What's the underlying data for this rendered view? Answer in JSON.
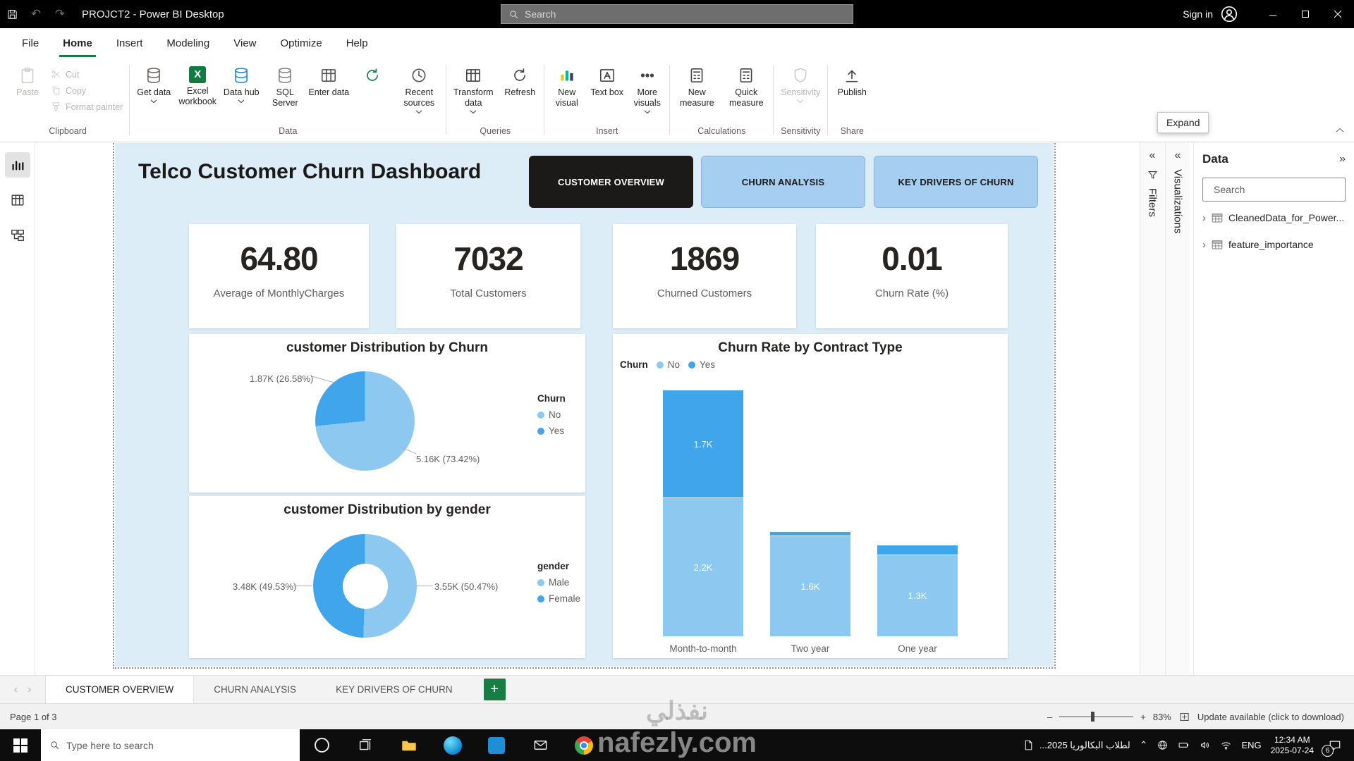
{
  "titlebar": {
    "title": "PROJCT2 - Power BI Desktop",
    "search_placeholder": "Search",
    "sign_in_label": "Sign in"
  },
  "menubar": {
    "items": [
      "File",
      "Home",
      "Insert",
      "Modeling",
      "View",
      "Optimize",
      "Help"
    ],
    "active_item": "Home"
  },
  "ribbon": {
    "clipboard": {
      "label": "Clipboard",
      "paste": "Paste",
      "cut": "Cut",
      "copy": "Copy",
      "format_painter": "Format painter"
    },
    "data": {
      "label": "Data",
      "get_data": "Get data",
      "excel_workbook": "Excel workbook",
      "data_hub": "Data hub",
      "sql_server": "SQL Server",
      "enter_data": "Enter data",
      "dataverse": "Dataverse",
      "recent_sources": "Recent sources"
    },
    "queries": {
      "label": "Queries",
      "transform_data": "Transform data",
      "refresh": "Refresh"
    },
    "insert": {
      "label": "Insert",
      "new_visual": "New visual",
      "text_box": "Text box",
      "more_visuals": "More visuals"
    },
    "calculations": {
      "label": "Calculations",
      "new_measure": "New measure",
      "quick_measure": "Quick measure"
    },
    "sensitivity": {
      "label": "Sensitivity",
      "sensitivity": "Sensitivity"
    },
    "share": {
      "label": "Share",
      "publish": "Publish"
    }
  },
  "expand_tooltip": "Expand",
  "side_panels": {
    "filters_title": "Filters",
    "visualizations_title": "Visualizations",
    "data_panel": {
      "title": "Data",
      "search_placeholder": "Search",
      "tables": [
        "CleanedData_for_Power...",
        "feature_importance"
      ]
    }
  },
  "dashboard": {
    "title": "Telco Customer Churn Dashboard",
    "nav_buttons": [
      "CUSTOMER OVERVIEW",
      "CHURN ANALYSIS",
      "KEY DRIVERS OF CHURN"
    ],
    "kpis": [
      {
        "value": "64.80",
        "label": "Average of MonthlyCharges"
      },
      {
        "value": "7032",
        "label": "Total Customers"
      },
      {
        "value": "1869",
        "label": "Churned Customers"
      },
      {
        "value": "0.01",
        "label": "Churn Rate (%)"
      }
    ]
  },
  "chart_data": [
    {
      "type": "pie",
      "title": "customer Distribution by Churn",
      "legend_title": "Churn",
      "labels": [
        "No",
        "Yes"
      ],
      "values": [
        5160,
        1870
      ],
      "value_labels": [
        "5.16K (73.42%)",
        "1.87K (26.58%)"
      ],
      "colors": [
        "#8dc8f1",
        "#41a5ec"
      ]
    },
    {
      "type": "pie",
      "subtype": "donut",
      "title": "customer Distribution by gender",
      "legend_title": "gender",
      "labels": [
        "Male",
        "Female"
      ],
      "values": [
        3550,
        3480
      ],
      "value_labels": [
        "3.55K (50.47%)",
        "3.48K (49.53%)"
      ],
      "colors": [
        "#8dc8f1",
        "#41a5ec"
      ]
    },
    {
      "type": "bar",
      "subtype": "stacked-column",
      "title": "Churn Rate by Contract Type",
      "legend_title": "Churn",
      "categories": [
        "Month-to-month",
        "Two year",
        "One year"
      ],
      "series": [
        {
          "name": "No",
          "values": [
            2200,
            1600,
            1300
          ],
          "labels": [
            "2.2K",
            "1.6K",
            "1.3K"
          ]
        },
        {
          "name": "Yes",
          "values": [
            1700,
            60,
            140
          ],
          "labels": [
            "1.7K",
            "",
            ""
          ]
        }
      ],
      "colors": [
        "#8dc8f1",
        "#41a5ec"
      ],
      "ylim": [
        0,
        3900
      ]
    }
  ],
  "page_tabs": {
    "tabs": [
      "CUSTOMER OVERVIEW",
      "CHURN ANALYSIS",
      "KEY DRIVERS OF CHURN"
    ],
    "active_tab": "CUSTOMER OVERVIEW"
  },
  "statusbar": {
    "page_indicator": "Page 1 of 3",
    "zoom_level": "83%",
    "update_message": "Update available (click to download)"
  },
  "taskbar": {
    "search_placeholder": "Type here to search",
    "document_title": "لطلاب البكالوريا 2025...",
    "language": "ENG",
    "time": "12:34 AM",
    "date": "2025-07-24",
    "notification_count": "6"
  },
  "watermark": {
    "arabic": "نفذلي",
    "domain": "nafezly.com"
  }
}
